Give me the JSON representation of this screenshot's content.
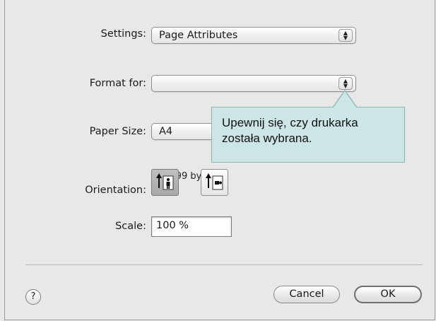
{
  "settings": {
    "label": "Settings:",
    "value": "Page Attributes"
  },
  "format_for": {
    "label": "Format for:",
    "value": ""
  },
  "paper_size": {
    "label": "Paper Size:",
    "value": "A4",
    "dimensions": "20.99 by 2"
  },
  "tooltip": {
    "text": "Upewnij się, czy drukarka została wybrana."
  },
  "orientation": {
    "label": "Orientation:",
    "options": [
      "portrait",
      "landscape"
    ],
    "selected": "portrait"
  },
  "scale": {
    "label": "Scale:",
    "value": "100 %"
  },
  "buttons": {
    "help": "?",
    "cancel": "Cancel",
    "ok": "OK"
  },
  "icons": [
    "popup-arrows-icon",
    "portrait-orientation-icon",
    "landscape-orientation-icon",
    "help-icon"
  ]
}
